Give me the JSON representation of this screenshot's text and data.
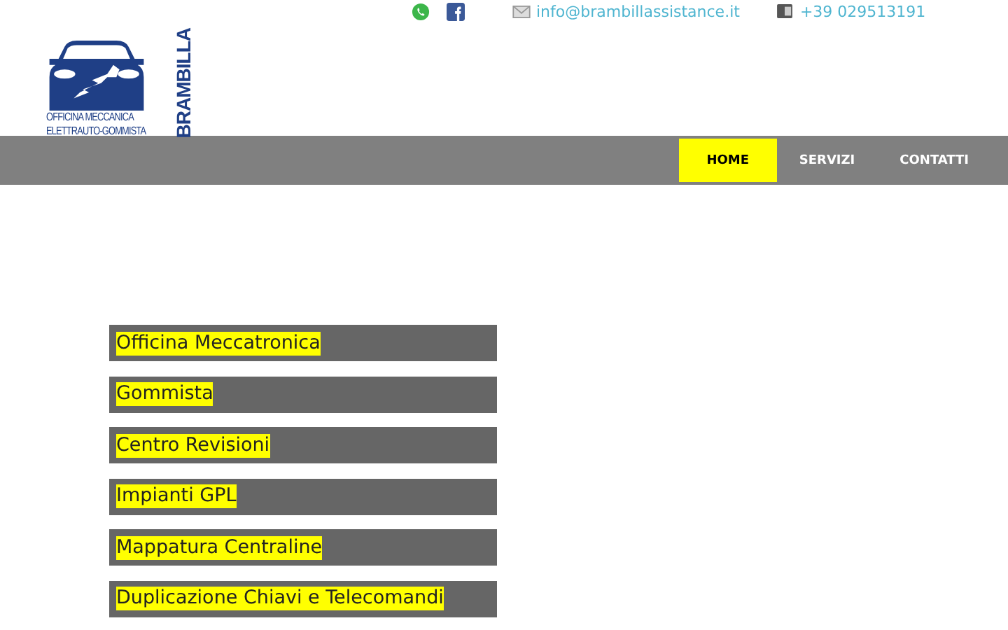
{
  "logo": {
    "line_1": "OFFICINA MECCANICA",
    "line_2": "ELETTRAUTO-GOMMISTA",
    "name": "BRAMBILLA"
  },
  "contacts": {
    "email": "info@brambillassistance.it",
    "phone": "+39 029513191"
  },
  "nav": [
    {
      "label": "HOME",
      "selected": true
    },
    {
      "label": "SERVIZI",
      "selected": false
    },
    {
      "label": "CONTATTI",
      "selected": false
    }
  ],
  "services": [
    "Officina Meccatronica",
    "Gommista",
    "Centro Revisioni",
    "Impianti GPL",
    "Mappatura Centraline",
    "Duplicazione Chiavi e Telecomandi"
  ]
}
